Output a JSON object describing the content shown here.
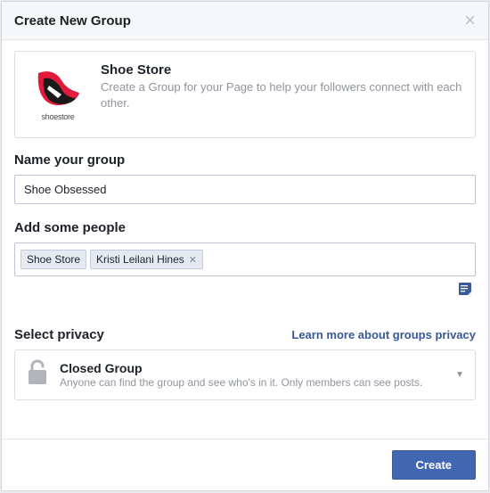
{
  "header": {
    "title": "Create New Group"
  },
  "page_card": {
    "name": "Shoe Store",
    "logo_caption": "shoestore",
    "description": "Create a Group for your Page to help your followers connect with each other."
  },
  "name_section": {
    "label": "Name your group",
    "value": "Shoe Obsessed"
  },
  "people_section": {
    "label": "Add some people",
    "chips": [
      {
        "label": "Shoe Store",
        "removable": false
      },
      {
        "label": "Kristi Leilani Hines",
        "removable": true
      }
    ]
  },
  "privacy_section": {
    "label": "Select privacy",
    "learn_more": "Learn more about groups privacy",
    "selected": {
      "title": "Closed Group",
      "description": "Anyone can find the group and see who's in it. Only members can see posts."
    }
  },
  "footer": {
    "create_label": "Create"
  }
}
